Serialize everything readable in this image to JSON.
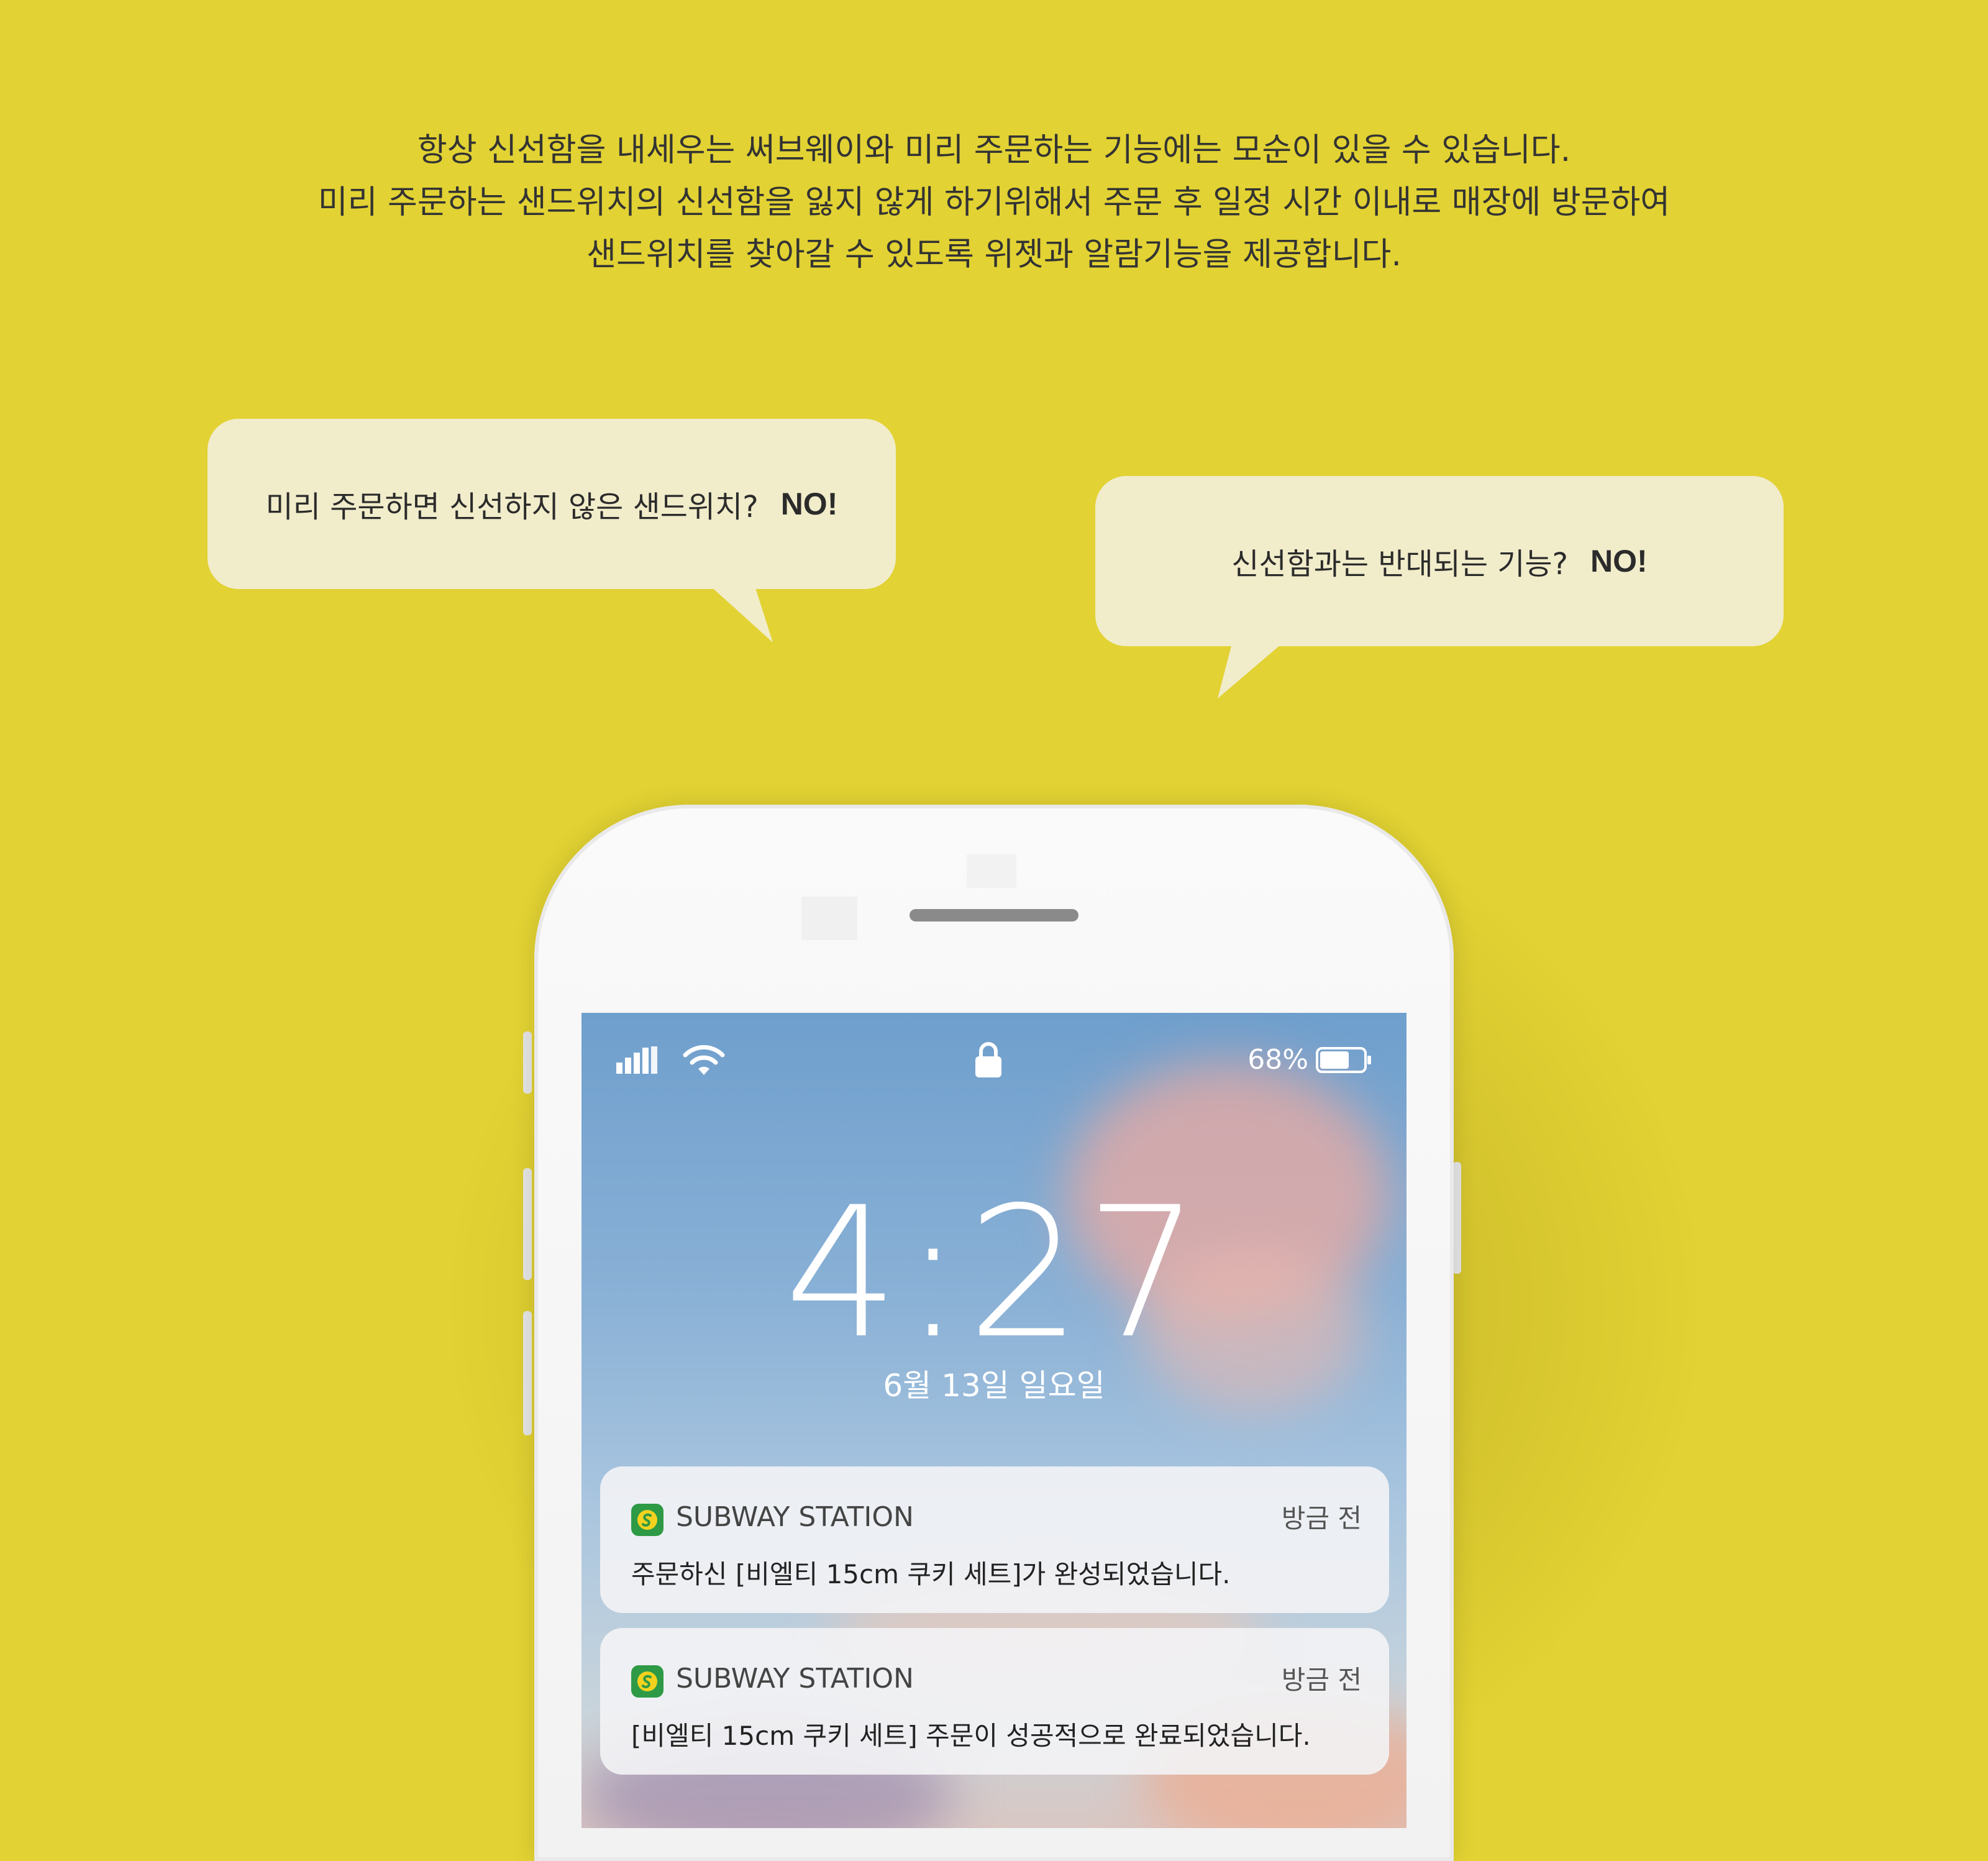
{
  "intro": {
    "line1": "항상 신선함을 내세우는 써브웨이와 미리 주문하는 기능에는 모순이 있을 수 있습니다.",
    "line2": "미리 주문하는 샌드위치의 신선함을 잃지 않게 하기위해서 주문 후 일정 시간 이내로 매장에 방문하여",
    "line3": "샌드위치를 찾아갈 수 있도록 위젯과 알람기능을 제공합니다."
  },
  "bubbles": [
    {
      "question": "미리 주문하면 신선하지 않은 샌드위치?",
      "answer": "NO!"
    },
    {
      "question": "신선함과는 반대되는 기능?",
      "answer": "NO!"
    }
  ],
  "lockscreen": {
    "battery_percent": "68%",
    "battery_level": 0.68,
    "time": "4:27",
    "date": "6월 13일 일요일",
    "icons": [
      "signal-icon",
      "wifi-icon",
      "lock-icon",
      "battery-icon"
    ],
    "notifications": [
      {
        "app": "SUBWAY STATION",
        "when": "방금 전",
        "message": "주문하신 [비엘티 15cm 쿠키 세트]가 완성되었습니다."
      },
      {
        "app": "SUBWAY STATION",
        "when": "방금 전",
        "message": "[비엘티 15cm 쿠키 세트] 주문이 성공적으로 완료되었습니다."
      }
    ]
  },
  "colors": {
    "background": "#e2d233",
    "bubble": "#f1ecca",
    "app_icon": "#2e9a45"
  }
}
